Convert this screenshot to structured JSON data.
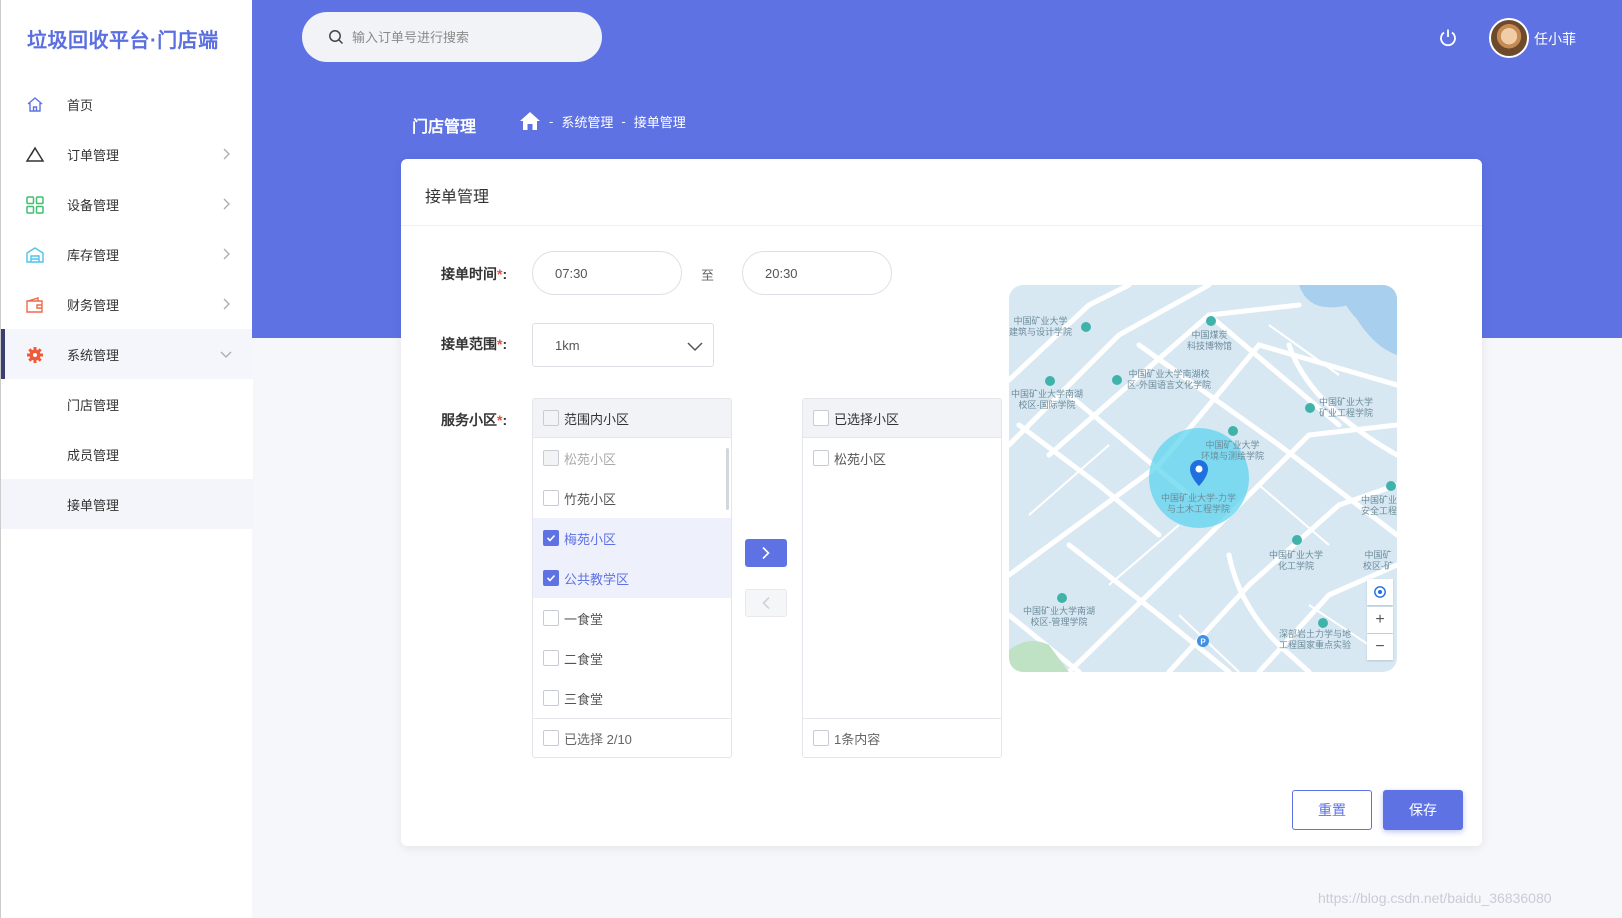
{
  "app": {
    "title": "垃圾回收平台·门店端"
  },
  "sidebar": {
    "items": [
      {
        "label": "首页",
        "icon": "home-icon"
      },
      {
        "label": "订单管理",
        "icon": "triangle-icon"
      },
      {
        "label": "设备管理",
        "icon": "grid-icon"
      },
      {
        "label": "库存管理",
        "icon": "warehouse-icon"
      },
      {
        "label": "财务管理",
        "icon": "wallet-icon"
      },
      {
        "label": "系统管理",
        "icon": "gear-icon"
      }
    ],
    "sub_items": [
      {
        "label": "门店管理"
      },
      {
        "label": "成员管理"
      },
      {
        "label": "接单管理"
      }
    ]
  },
  "header": {
    "search_placeholder": "输入订单号进行搜索",
    "username": "任小菲"
  },
  "breadcrumb": {
    "page_title": "门店管理",
    "sep1": "-",
    "level1": "系统管理",
    "sep2": "-",
    "level2": "接单管理"
  },
  "card": {
    "title": "接单管理",
    "time_label": "接单时间",
    "time_start": "07:30",
    "time_to": "至",
    "time_end": "20:30",
    "range_label": "接单范围",
    "range_value": "1km",
    "service_label": "服务小区",
    "required_mark": "*",
    "colon": ":",
    "left_panel": {
      "title": "范围内小区",
      "items": [
        {
          "label": "松苑小区",
          "state": "disabled"
        },
        {
          "label": "竹苑小区",
          "state": "unchecked"
        },
        {
          "label": "梅苑小区",
          "state": "checked"
        },
        {
          "label": "公共教学区",
          "state": "checked"
        },
        {
          "label": "一食堂",
          "state": "unchecked"
        },
        {
          "label": "二食堂",
          "state": "unchecked"
        },
        {
          "label": "三食堂",
          "state": "unchecked"
        }
      ],
      "footer": "已选择 2/10"
    },
    "right_panel": {
      "title": "已选择小区",
      "items": [
        {
          "label": "松苑小区",
          "state": "unchecked"
        }
      ],
      "footer": "1条内容"
    },
    "reset_label": "重置",
    "save_label": "保存"
  },
  "map": {
    "labels": [
      "中国矿业大学\n建筑与设计学院",
      "中国煤炭\n科技博物馆",
      "中国矿业大学南湖校\n区-外国语言文化学院",
      "中国矿业大学南湖\n校区-国际学院",
      "中国矿业大学\n矿业工程学院",
      "中国矿业大学\n环境与测绘学院",
      "中国矿业大学-力学\n与土木工程学院",
      "中国矿业\n安全工程",
      "中国矿业大学\n化工学院",
      "中国矿\n校区-矿",
      "中国矿业大学南湖\n校区-管理学院",
      "深部岩土力学与地\n工程国家重点实验"
    ],
    "zoom_in": "+",
    "zoom_out": "−"
  },
  "watermark": "https://blog.csdn.net/baidu_36836080",
  "colors": {
    "primary": "#5e72e4",
    "danger": "#e74c3c"
  }
}
